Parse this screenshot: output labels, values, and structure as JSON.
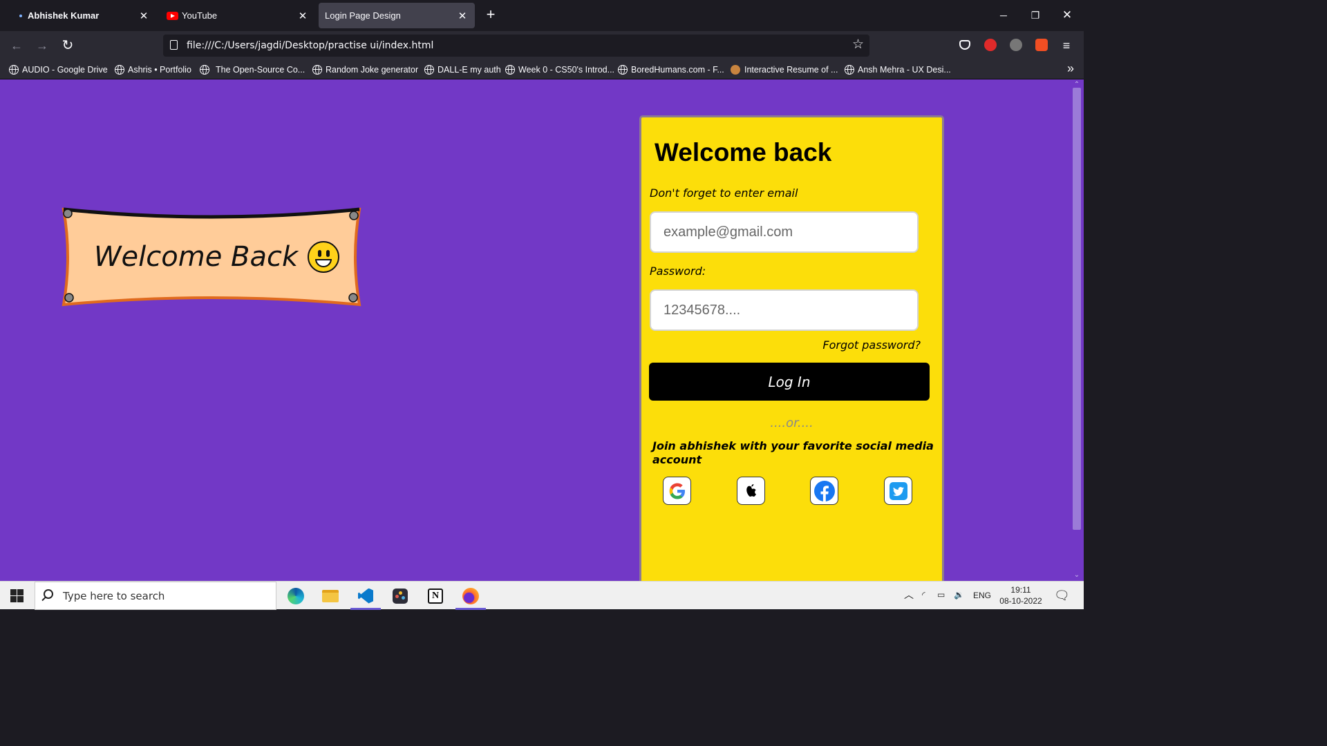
{
  "browser": {
    "tabs": [
      {
        "title": "Abhishek Kumar",
        "active": false
      },
      {
        "title": "YouTube",
        "active": false
      },
      {
        "title": "Login Page Design",
        "active": true
      }
    ],
    "new_tab_label": "+",
    "url": "file:///C:/Users/jagdi/Desktop/practise ui/index.html",
    "bookmarks": [
      "AUDIO - Google Drive",
      "Ashris • Portfolio",
      "The Open-Source Co...",
      "Random Joke generator",
      "DALL-E my auth",
      "Week 0 - CS50's Introd...",
      "BoredHumans.com - F...",
      "Interactive Resume of ...",
      "Ansh Mehra - UX Desi..."
    ]
  },
  "banner": {
    "text": "Welcome Back"
  },
  "login": {
    "title": "Welcome back",
    "email_label": "Don't forget to enter email",
    "email_placeholder": "example@gmail.com",
    "password_label": "Password:",
    "password_placeholder": "12345678....",
    "forgot_label": "Forgot password?",
    "login_button": "Log In",
    "or_text": "....or....",
    "join_text": "Join abhishek with your favorite social media account",
    "social": [
      "google-icon",
      "apple-icon",
      "facebook-icon",
      "twitter-icon"
    ]
  },
  "taskbar": {
    "search_placeholder": "Type here to search",
    "language": "ENG",
    "time": "19:11",
    "date": "08-10-2022"
  },
  "colors": {
    "page_bg": "#7238c6",
    "card_bg": "#fcde0a",
    "banner_fill": "#ffcc99",
    "banner_edge": "#e06a1e"
  }
}
